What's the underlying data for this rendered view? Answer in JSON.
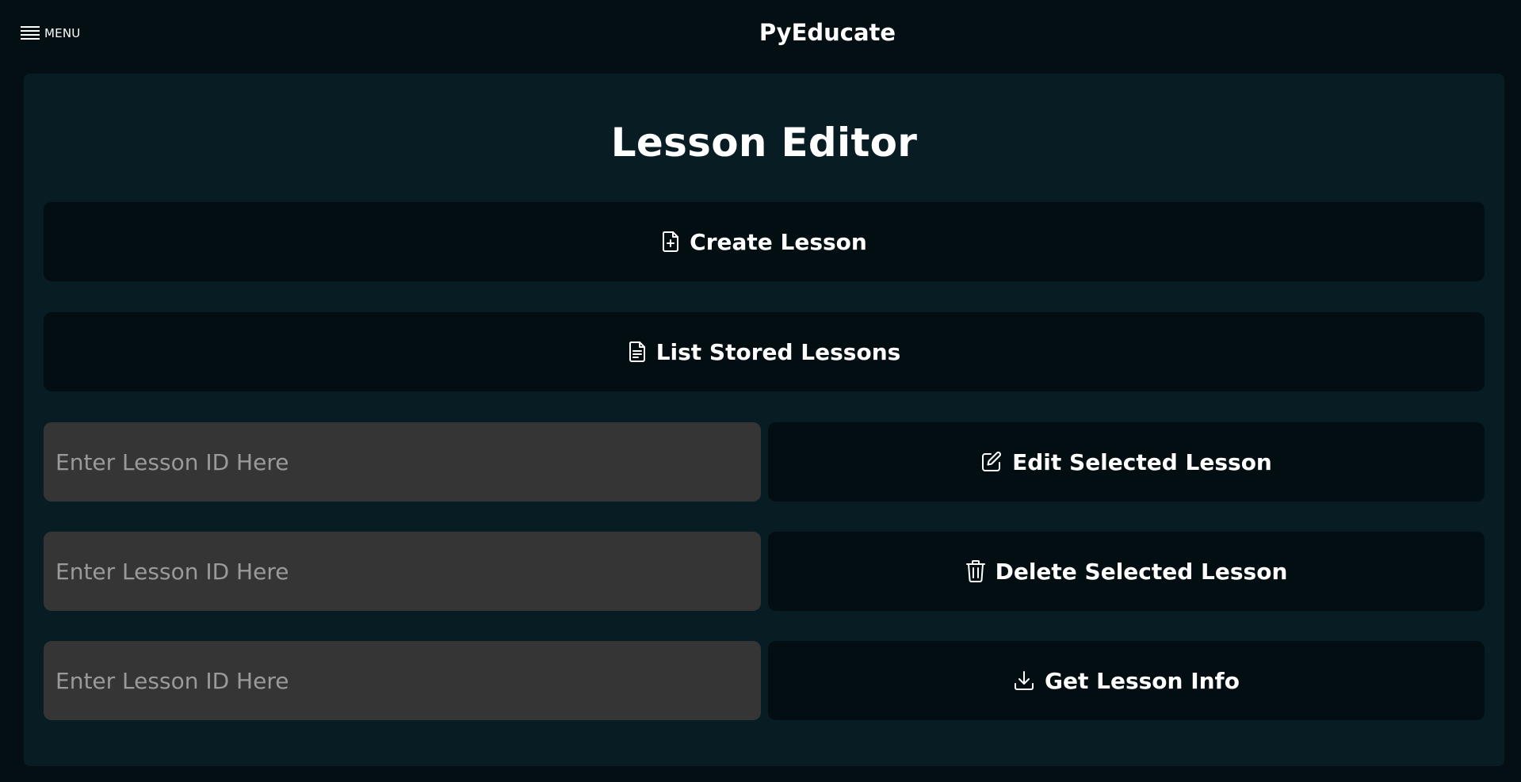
{
  "header": {
    "menu_label": "MENU",
    "app_title": "PyEducate"
  },
  "editor": {
    "title": "Lesson Editor",
    "create_label": "Create Lesson",
    "list_label": "List Stored Lessons",
    "edit_label": "Edit Selected Lesson",
    "delete_label": "Delete Selected Lesson",
    "info_label": "Get Lesson Info",
    "edit_input": {
      "value": "",
      "placeholder": "Enter Lesson ID Here"
    },
    "delete_input": {
      "value": "",
      "placeholder": "Enter Lesson ID Here"
    },
    "info_input": {
      "value": "",
      "placeholder": "Enter Lesson ID Here"
    }
  },
  "icons": {
    "menu": "hamburger-icon",
    "create": "file-plus-icon",
    "list": "file-text-icon",
    "edit": "pencil-square-icon",
    "delete": "trash-icon",
    "info": "download-icon"
  },
  "colors": {
    "page_background": "#040f14",
    "panel_background": "#081c24",
    "button_background": "#030e13",
    "input_background": "#353535",
    "placeholder_text": "#9a9a9a",
    "text": "#ffffff"
  }
}
